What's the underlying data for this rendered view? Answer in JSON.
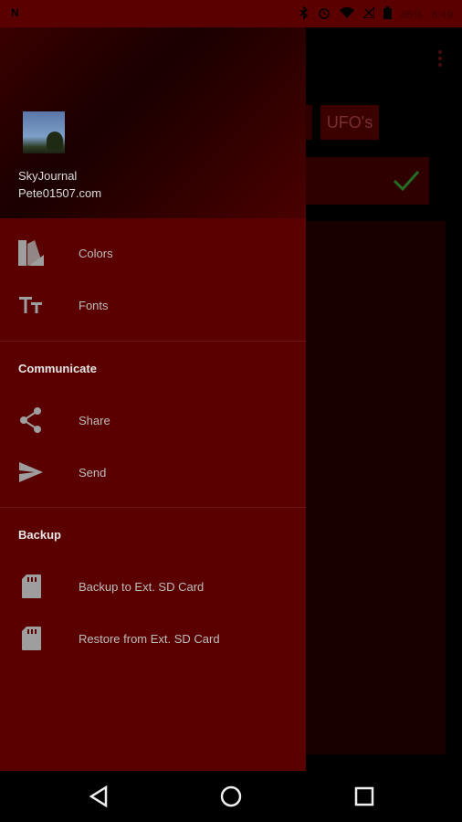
{
  "status_bar": {
    "left_icon": "N",
    "battery": "86%",
    "time": "8:49"
  },
  "background": {
    "chip_label": "UFO's",
    "check_color": "#2e8b2e"
  },
  "drawer": {
    "header": {
      "title": "SkyJournal",
      "subtitle": "Pete01507.com"
    },
    "items_top": [
      {
        "label": "Colors",
        "icon": "palette-icon"
      },
      {
        "label": "Fonts",
        "icon": "font-size-icon"
      }
    ],
    "sections": [
      {
        "title": "Communicate",
        "items": [
          {
            "label": "Share",
            "icon": "share-icon"
          },
          {
            "label": "Send",
            "icon": "send-icon"
          }
        ]
      },
      {
        "title": "Backup",
        "items": [
          {
            "label": "Backup to Ext. SD Card",
            "icon": "sd-card-icon"
          },
          {
            "label": "Restore from Ext. SD Card",
            "icon": "sd-card-icon"
          }
        ]
      }
    ]
  },
  "colors": {
    "drawer_bg": "#5a0000",
    "icon_grey": "#9e9e9e",
    "label_grey": "#bdbdbd"
  }
}
